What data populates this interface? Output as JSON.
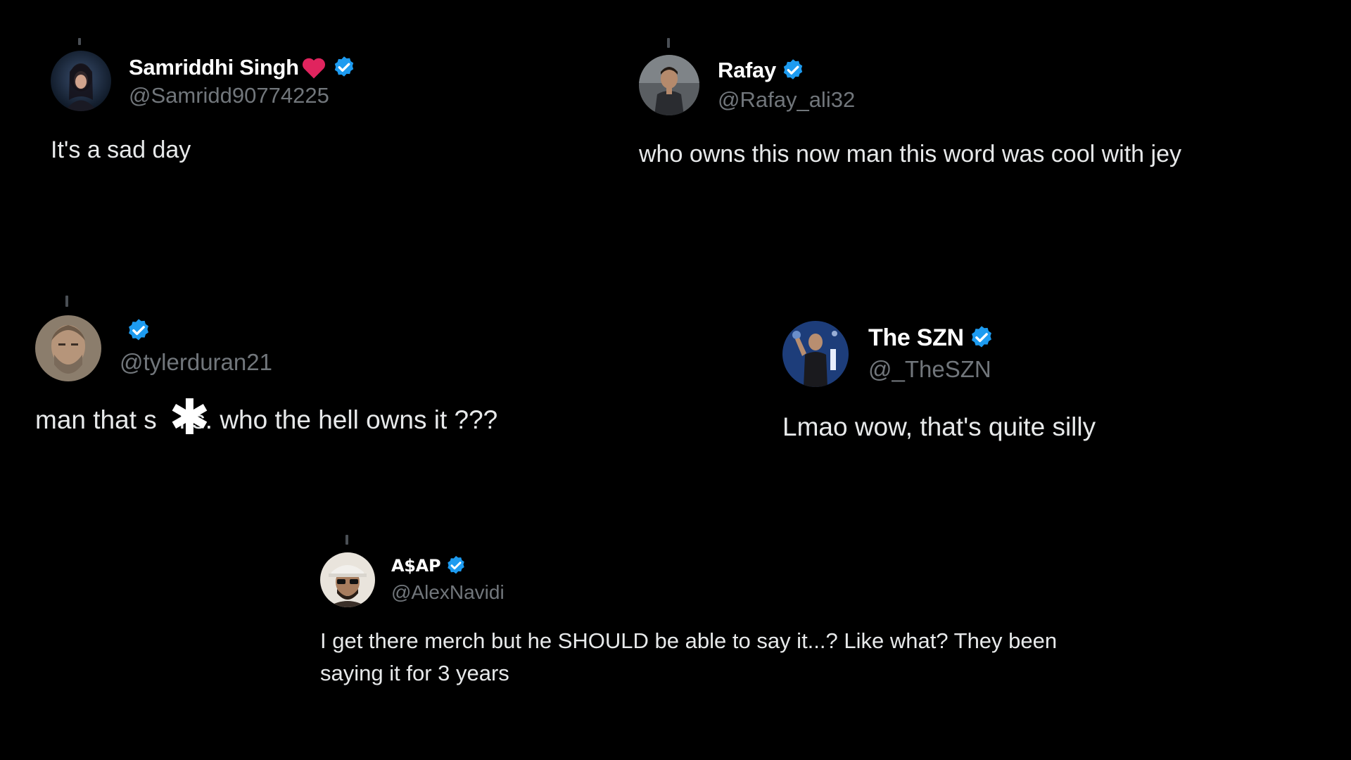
{
  "colors": {
    "background": "#000000",
    "text": "#e7e9ea",
    "handle": "#71767b",
    "verified": "#1d9bf0",
    "heart": "#e0245e"
  },
  "tweets": [
    {
      "display_name": "Samriddhi Singh",
      "handle": "@Samridd90774225",
      "text": "It's a sad day",
      "icons": [
        "avatar",
        "heart-icon",
        "verified-icon"
      ]
    },
    {
      "display_name": "Rafay",
      "handle": "@Rafay_ali32",
      "text": "who owns this now man this word was cool with jey",
      "icons": [
        "avatar",
        "verified-icon"
      ]
    },
    {
      "display_name": "",
      "handle": "@tylerduran21",
      "text_before": "man that s",
      "censor": "✱",
      "text_after": "ks. who the hell owns it ???",
      "icons": [
        "avatar",
        "verified-icon",
        "censor-asterisk-icon"
      ]
    },
    {
      "display_name": "The SZN",
      "handle": "@_TheSZN",
      "text": "Lmao wow, that's quite silly",
      "icons": [
        "avatar",
        "verified-icon"
      ]
    },
    {
      "display_name": "A$AP",
      "handle": "@AlexNavidi",
      "text": "I get there merch but he SHOULD be able to say it...? Like what? They been saying it for 3 years",
      "icons": [
        "avatar",
        "verified-icon"
      ]
    }
  ]
}
